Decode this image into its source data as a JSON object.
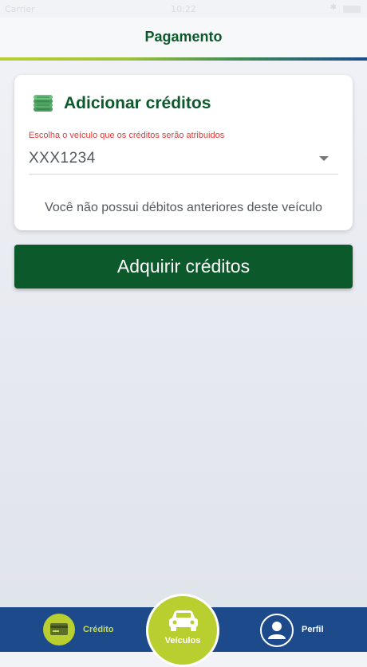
{
  "status_bar": {
    "carrier": "Carrier",
    "time": "10:22"
  },
  "header": {
    "title": "Pagamento"
  },
  "card": {
    "icon": "coins-icon",
    "title": "Adicionar créditos",
    "select_hint": "Escolha o veículo que os créditos serão atribuidos",
    "selected_vehicle": "XXX1234",
    "info": "Você não possui débitos anteriores deste veículo"
  },
  "cta": {
    "label": "Adquirir créditos"
  },
  "tab_bar": {
    "credit": {
      "label": "Crédito",
      "icon": "card-icon"
    },
    "vehicles": {
      "label": "Veículos",
      "icon": "car-icon"
    },
    "profile": {
      "label": "Perfil",
      "icon": "user-icon"
    }
  },
  "colors": {
    "brand_green": "#0c5a2b",
    "accent_lime": "#b9cf2f",
    "tab_bar_blue": "#1c4a8a",
    "hint_red": "#e53935"
  }
}
